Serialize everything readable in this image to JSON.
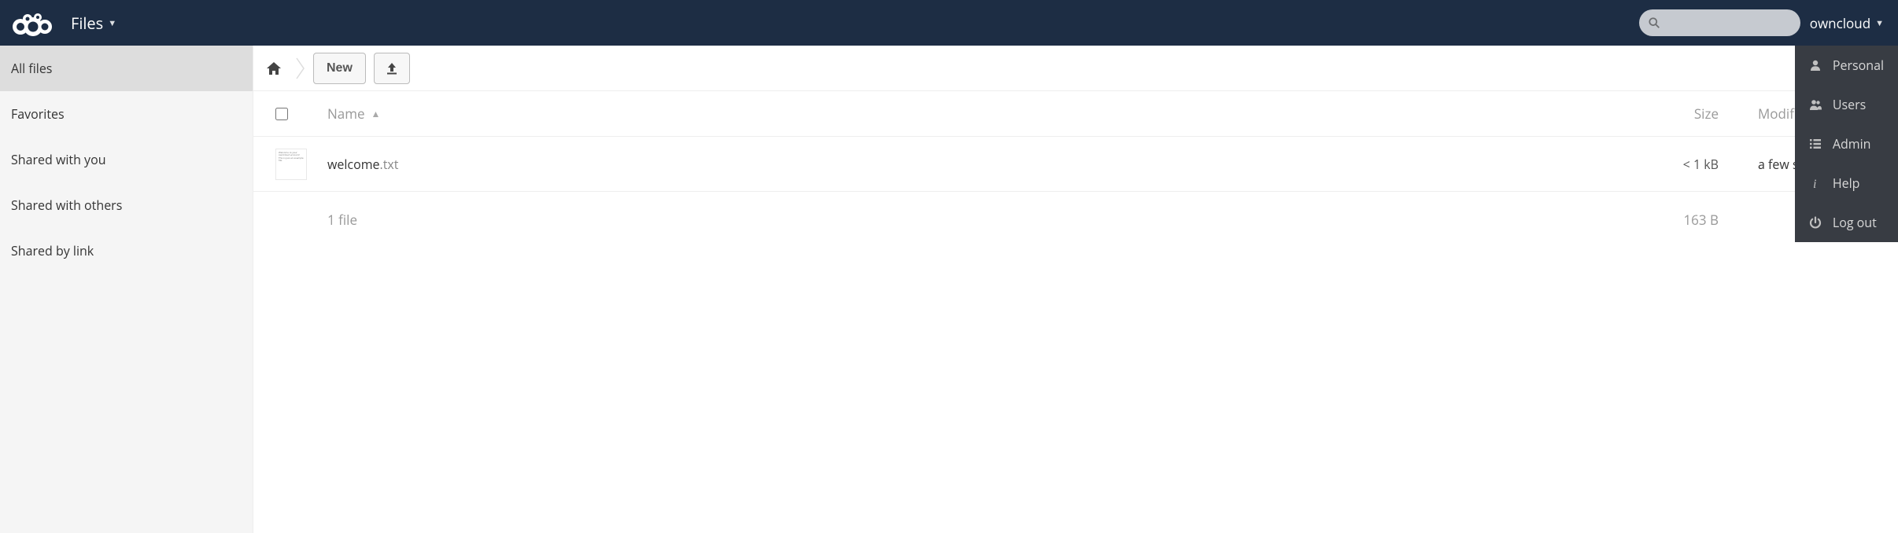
{
  "header": {
    "app_name": "Files",
    "search_placeholder": "",
    "username": "owncloud"
  },
  "user_menu": {
    "items": [
      {
        "label": "Personal"
      },
      {
        "label": "Users"
      },
      {
        "label": "Admin"
      },
      {
        "label": "Help"
      },
      {
        "label": "Log out"
      }
    ]
  },
  "sidebar": {
    "items": [
      {
        "label": "All files",
        "active": true
      },
      {
        "label": "Favorites",
        "active": false
      },
      {
        "label": "Shared with you",
        "active": false
      },
      {
        "label": "Shared with others",
        "active": false
      },
      {
        "label": "Shared by link",
        "active": false
      }
    ]
  },
  "controls": {
    "new_label": "New"
  },
  "table": {
    "header": {
      "name": "Name",
      "size": "Size",
      "modified": "Modified"
    },
    "rows": [
      {
        "name": "welcome",
        "ext": ".txt",
        "size": "< 1 kB",
        "modified": "a few seconds ago"
      }
    ],
    "summary": {
      "count_text": "1 file",
      "total_size": "163 B"
    }
  }
}
